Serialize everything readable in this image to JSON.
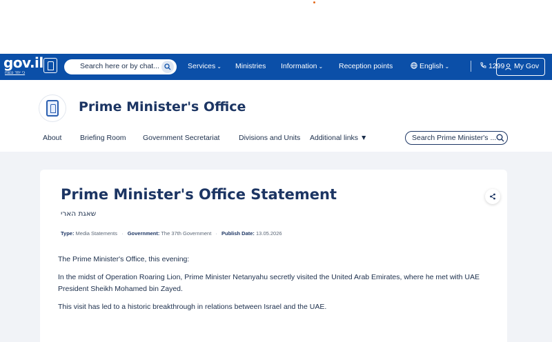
{
  "header": {
    "logo_text": "gov.il",
    "logo_sub": "כי יחד ננצח",
    "search_placeholder": "Search here or by chat...",
    "nav": [
      {
        "label": "Services",
        "caret": true
      },
      {
        "label": "Ministries",
        "caret": false
      },
      {
        "label": "Information",
        "caret": true
      },
      {
        "label": "Reception points",
        "caret": false
      }
    ],
    "language": "English",
    "phone": "1299",
    "mygov": "My Gov"
  },
  "ministry": {
    "title": "Prime Minister's Office",
    "subnav": [
      "About",
      "Briefing Room",
      "Government Secretariat",
      "Divisions and Units",
      "Additional links ▼"
    ],
    "search_placeholder": "Search Prime Minister's ..."
  },
  "article": {
    "title": "Prime Minister's Office Statement",
    "hebrew_subtitle": "שאגת הארי",
    "meta": {
      "type_label": "Type:",
      "type_value": "Media Statements",
      "government_label": "Government:",
      "government_value": "The 37th Government",
      "date_label": "Publish Date:",
      "date_value": "13.05.2026"
    },
    "paragraphs": [
      "The Prime Minister's Office, this evening:",
      "In the midst of Operation Roaring Lion, Prime Minister Netanyahu secretly visited the United Arab Emirates, where he met with UAE President Sheikh Mohamed bin Zayed.",
      "This visit has led to a historic breakthrough in relations between Israel and the UAE."
    ]
  },
  "colors": {
    "navbar": "#0b4fa8",
    "title": "#1c3563",
    "background": "#f1f3f7"
  }
}
